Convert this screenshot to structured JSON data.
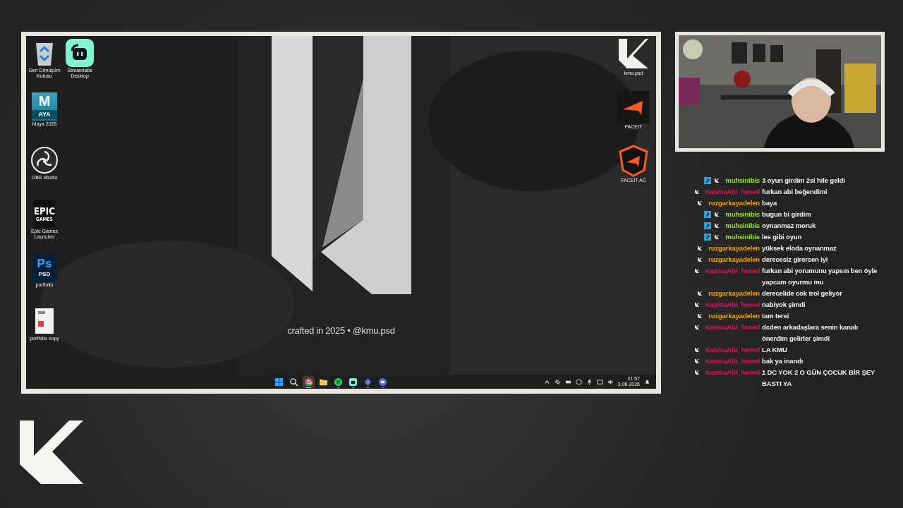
{
  "desktop": {
    "icon_columns": [
      {
        "icons": [
          {
            "kind": "recycle-bin",
            "label": "Geri Dönüşüm Kutusu"
          },
          {
            "kind": "maya",
            "label": "Maya 2025",
            "logo_text": [
              "M",
              "AYA"
            ]
          },
          {
            "kind": "obs",
            "label": "OBS Studio"
          },
          {
            "kind": "epic",
            "label": "Epic Games Launcher",
            "logo_text": [
              "EPIC",
              "GAMES"
            ]
          },
          {
            "kind": "photoshop",
            "label": "portfolio",
            "logo_text": [
              "Ps",
              "PSD"
            ]
          },
          {
            "kind": "document",
            "label": "portfolio copy"
          }
        ]
      },
      {
        "icons": [
          {
            "kind": "streamlabs",
            "label": "Streamlabs Desktop"
          }
        ]
      }
    ],
    "right_icons": [
      {
        "kind": "k-logo",
        "label": "kmu.psd"
      },
      {
        "kind": "faceit",
        "label": "FACEIT"
      },
      {
        "kind": "faceit-ac",
        "label": "FACEIT AC"
      }
    ],
    "wallpaper_caption": "crafted in 2025 • @kmu.psd",
    "taskbar": {
      "apps": [
        {
          "kind": "windows",
          "running": false,
          "active": false
        },
        {
          "kind": "search",
          "running": false,
          "active": false
        },
        {
          "kind": "chrome",
          "running": true,
          "active": true
        },
        {
          "kind": "folder",
          "running": false,
          "active": false
        },
        {
          "kind": "spotify",
          "running": true,
          "active": false
        },
        {
          "kind": "streamlabs",
          "running": true,
          "active": false
        },
        {
          "kind": "diamond",
          "running": true,
          "active": false
        },
        {
          "kind": "discord",
          "running": true,
          "active": false
        }
      ],
      "time": "21:57",
      "date": "3.08.2026"
    }
  },
  "chat": [
    {
      "user": "muhsinibis",
      "color": "#9be22d",
      "moderator": true,
      "message": "3 oyun girdim 2si hile geldi"
    },
    {
      "user": "KasmaAbi_hexed",
      "color": "#d8175a",
      "moderator": false,
      "message": "furkan abi beğendimi"
    },
    {
      "user": "ruzgarkayadelen",
      "color": "#e8a21a",
      "moderator": false,
      "message": "baya"
    },
    {
      "user": "muhsinibis",
      "color": "#9be22d",
      "moderator": true,
      "message": "bugun bi girdim"
    },
    {
      "user": "muhsinibis",
      "color": "#9be22d",
      "moderator": true,
      "message": "oynanmaz moruk"
    },
    {
      "user": "muhsinibis",
      "color": "#9be22d",
      "moderator": true,
      "message": "les gibi oyun"
    },
    {
      "user": "ruzgarkayadelen",
      "color": "#e8a21a",
      "moderator": false,
      "message": "yüksek eloda oynanmaz"
    },
    {
      "user": "ruzgarkayadelen",
      "color": "#e8a21a",
      "moderator": false,
      "message": "derecesiz girersen iyi"
    },
    {
      "user": "KasmaAbi_hexed",
      "color": "#d8175a",
      "moderator": false,
      "message": "furkan abi yorumunu yapsın ben öyle yapcam oyurmu mu"
    },
    {
      "user": "ruzgarkayadelen",
      "color": "#e8a21a",
      "moderator": false,
      "message": "derecelide cok trol geliyor"
    },
    {
      "user": "KasmaAbi_hexed",
      "color": "#d8175a",
      "moderator": false,
      "message": "nabiyok şimdi"
    },
    {
      "user": "ruzgarkayadelen",
      "color": "#e8a21a",
      "moderator": false,
      "message": "tam tersi"
    },
    {
      "user": "KasmaAbi_hexed",
      "color": "#d8175a",
      "moderator": false,
      "message": "dcden arkadaşlara senin kanalı önerdim gelirler şimdi"
    },
    {
      "user": "KasmaAbi_hexed",
      "color": "#d8175a",
      "moderator": false,
      "message": "LA KMU"
    },
    {
      "user": "KasmaAbi_hexed",
      "color": "#d8175a",
      "moderator": false,
      "message": "bak ya inandı"
    },
    {
      "user": "KasmaAbi_hexed",
      "color": "#d8175a",
      "moderator": false,
      "message": "1 DC YOK 2 O GÜN ÇOCUK BİR ŞEY BASTI YA"
    }
  ]
}
